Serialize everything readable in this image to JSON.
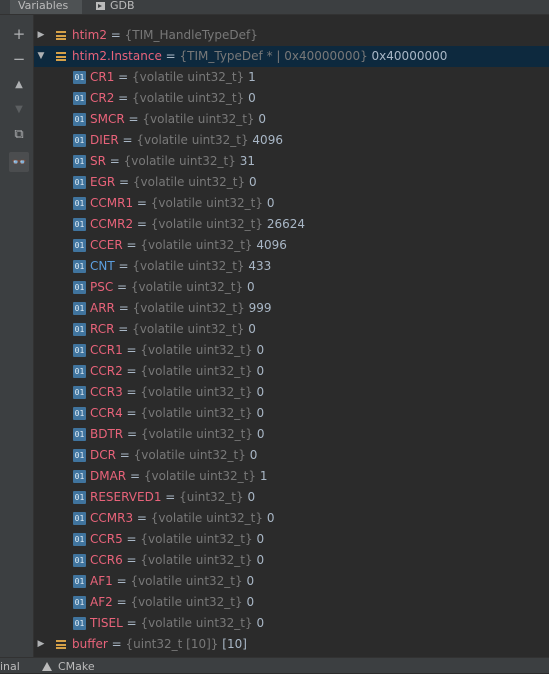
{
  "tabs": [
    {
      "label": "Variables"
    },
    {
      "label": "GDB"
    }
  ],
  "toolbar": [
    {
      "icon": "plus-icon",
      "glyph": "+"
    },
    {
      "icon": "minus-icon",
      "glyph": "−"
    },
    {
      "icon": "arrow-up-icon",
      "glyph": "▲"
    },
    {
      "icon": "arrow-down-icon",
      "glyph": "▼"
    },
    {
      "icon": "copy-icon",
      "glyph": "⧉"
    },
    {
      "icon": "glasses-icon",
      "glyph": "👓"
    }
  ],
  "variables": [
    {
      "name": "htim2",
      "type": "{TIM_HandleTypeDef}",
      "value": "",
      "kind": "object",
      "expanded": false
    },
    {
      "name": "htim2.Instance",
      "type": "{TIM_TypeDef * | 0x40000000}",
      "value": "0x40000000",
      "kind": "object",
      "expanded": true,
      "selected": true
    },
    {
      "name": "CR1",
      "type": "{volatile uint32_t}",
      "value": "1",
      "kind": "field"
    },
    {
      "name": "CR2",
      "type": "{volatile uint32_t}",
      "value": "0",
      "kind": "field"
    },
    {
      "name": "SMCR",
      "type": "{volatile uint32_t}",
      "value": "0",
      "kind": "field"
    },
    {
      "name": "DIER",
      "type": "{volatile uint32_t}",
      "value": "4096",
      "kind": "field"
    },
    {
      "name": "SR",
      "type": "{volatile uint32_t}",
      "value": "31",
      "kind": "field"
    },
    {
      "name": "EGR",
      "type": "{volatile uint32_t}",
      "value": "0",
      "kind": "field"
    },
    {
      "name": "CCMR1",
      "type": "{volatile uint32_t}",
      "value": "0",
      "kind": "field"
    },
    {
      "name": "CCMR2",
      "type": "{volatile uint32_t}",
      "value": "26624",
      "kind": "field"
    },
    {
      "name": "CCER",
      "type": "{volatile uint32_t}",
      "value": "4096",
      "kind": "field"
    },
    {
      "name": "CNT",
      "type": "{volatile uint32_t}",
      "value": "433",
      "kind": "field",
      "changed": true
    },
    {
      "name": "PSC",
      "type": "{volatile uint32_t}",
      "value": "0",
      "kind": "field"
    },
    {
      "name": "ARR",
      "type": "{volatile uint32_t}",
      "value": "999",
      "kind": "field"
    },
    {
      "name": "RCR",
      "type": "{volatile uint32_t}",
      "value": "0",
      "kind": "field"
    },
    {
      "name": "CCR1",
      "type": "{volatile uint32_t}",
      "value": "0",
      "kind": "field"
    },
    {
      "name": "CCR2",
      "type": "{volatile uint32_t}",
      "value": "0",
      "kind": "field"
    },
    {
      "name": "CCR3",
      "type": "{volatile uint32_t}",
      "value": "0",
      "kind": "field"
    },
    {
      "name": "CCR4",
      "type": "{volatile uint32_t}",
      "value": "0",
      "kind": "field"
    },
    {
      "name": "BDTR",
      "type": "{volatile uint32_t}",
      "value": "0",
      "kind": "field"
    },
    {
      "name": "DCR",
      "type": "{volatile uint32_t}",
      "value": "0",
      "kind": "field"
    },
    {
      "name": "DMAR",
      "type": "{volatile uint32_t}",
      "value": "1",
      "kind": "field"
    },
    {
      "name": "RESERVED1",
      "type": "{uint32_t}",
      "value": "0",
      "kind": "field"
    },
    {
      "name": "CCMR3",
      "type": "{volatile uint32_t}",
      "value": "0",
      "kind": "field"
    },
    {
      "name": "CCR5",
      "type": "{volatile uint32_t}",
      "value": "0",
      "kind": "field"
    },
    {
      "name": "CCR6",
      "type": "{volatile uint32_t}",
      "value": "0",
      "kind": "field"
    },
    {
      "name": "AF1",
      "type": "{volatile uint32_t}",
      "value": "0",
      "kind": "field"
    },
    {
      "name": "AF2",
      "type": "{volatile uint32_t}",
      "value": "0",
      "kind": "field"
    },
    {
      "name": "TISEL",
      "type": "{volatile uint32_t}",
      "value": "0",
      "kind": "field"
    },
    {
      "name": "buffer",
      "type": "{uint32_t [10]}",
      "value": "[10]",
      "kind": "object",
      "expanded": false
    }
  ],
  "field_icon_label": "01",
  "statusbar": {
    "terminal_label": "inal",
    "cmake_label": "CMake"
  },
  "colors": {
    "background": "#2b2b2b",
    "variable_name": "#e8637a",
    "changed_name": "#5c9fe0",
    "type_text": "#787878",
    "field_icon": "#40749e",
    "object_icon": "#d6a148",
    "selection": "#0d293e"
  }
}
